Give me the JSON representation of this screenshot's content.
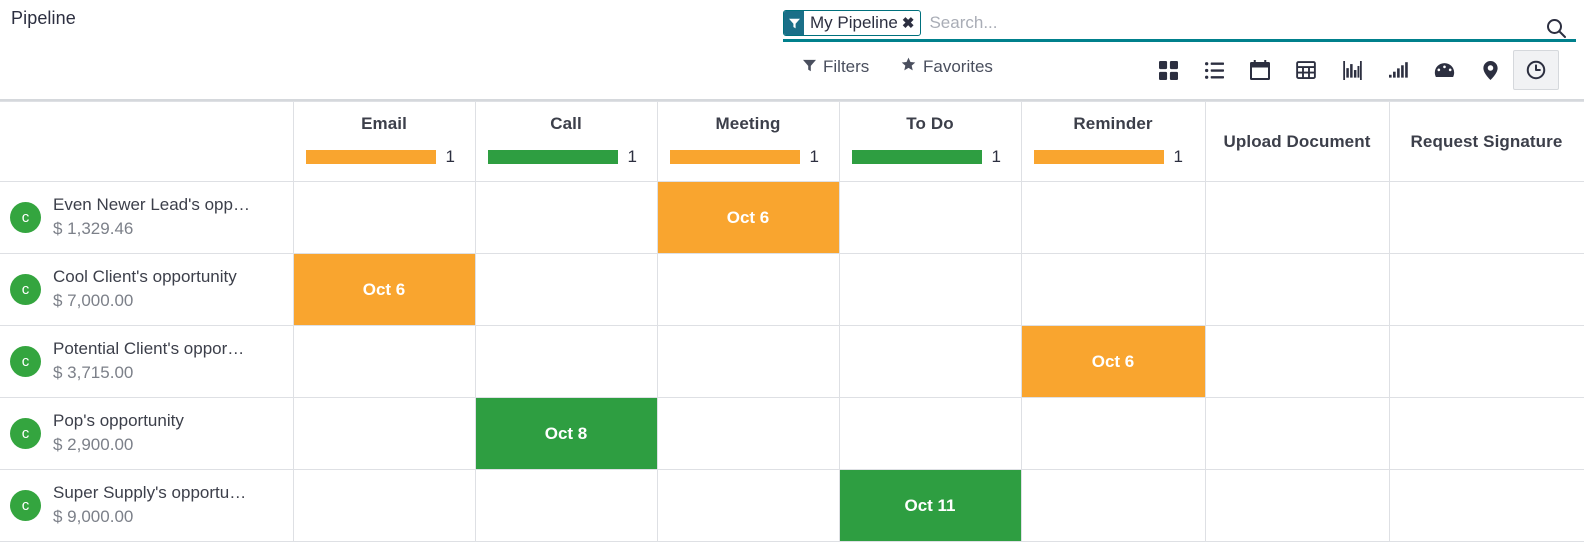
{
  "breadcrumb": "Pipeline",
  "search": {
    "facet": {
      "label": "My Pipeline",
      "icon": "filter-icon",
      "remove": "✖"
    },
    "placeholder": "Search...",
    "value": "",
    "magnifier_icon": "search-icon"
  },
  "controls": {
    "filters_label": "Filters",
    "favorites_label": "Favorites",
    "views": [
      {
        "name": "kanban",
        "label": "Kanban",
        "active": false
      },
      {
        "name": "list",
        "label": "List",
        "active": false
      },
      {
        "name": "calendar",
        "label": "Calendar",
        "active": false
      },
      {
        "name": "pivot",
        "label": "Pivot",
        "active": false
      },
      {
        "name": "graph",
        "label": "Graph",
        "active": false
      },
      {
        "name": "cohort",
        "label": "Cohort",
        "active": false
      },
      {
        "name": "dashboard",
        "label": "Dashboard",
        "active": false
      },
      {
        "name": "map",
        "label": "Map",
        "active": false
      },
      {
        "name": "activity",
        "label": "Activity",
        "active": true
      }
    ]
  },
  "colors": {
    "orange": "#f9a52f",
    "green": "#2e9e41",
    "avatar_green": "#34a53f",
    "accent_teal": "#00808c",
    "facet_blue": "#1a6f88"
  },
  "table": {
    "columns": [
      {
        "title": "Email",
        "bar": "orange",
        "count": "1"
      },
      {
        "title": "Call",
        "bar": "green",
        "count": "1"
      },
      {
        "title": "Meeting",
        "bar": "orange",
        "count": "1"
      },
      {
        "title": "To Do",
        "bar": "green",
        "count": "1"
      },
      {
        "title": "Reminder",
        "bar": "orange",
        "count": "1"
      },
      {
        "title": "Upload Document",
        "bar": null,
        "count": ""
      },
      {
        "title": "Request Signature",
        "bar": null,
        "count": ""
      }
    ],
    "rows": [
      {
        "avatar": "c",
        "name": "Even Newer Lead's opp…",
        "amount": "$ 1,329.46",
        "cells": [
          {
            "label": "",
            "state": "empty"
          },
          {
            "label": "",
            "state": "empty"
          },
          {
            "label": "Oct 6",
            "state": "orange"
          },
          {
            "label": "",
            "state": "empty"
          },
          {
            "label": "",
            "state": "empty"
          },
          {
            "label": "",
            "state": "empty"
          },
          {
            "label": "",
            "state": "empty"
          }
        ]
      },
      {
        "avatar": "c",
        "name": "Cool Client's opportunity",
        "amount": "$ 7,000.00",
        "cells": [
          {
            "label": "Oct 6",
            "state": "orange"
          },
          {
            "label": "",
            "state": "empty"
          },
          {
            "label": "",
            "state": "empty"
          },
          {
            "label": "",
            "state": "empty"
          },
          {
            "label": "",
            "state": "empty"
          },
          {
            "label": "",
            "state": "empty"
          },
          {
            "label": "",
            "state": "empty"
          }
        ]
      },
      {
        "avatar": "c",
        "name": "Potential Client's oppor…",
        "amount": "$ 3,715.00",
        "cells": [
          {
            "label": "",
            "state": "empty"
          },
          {
            "label": "",
            "state": "empty"
          },
          {
            "label": "",
            "state": "empty"
          },
          {
            "label": "",
            "state": "empty"
          },
          {
            "label": "Oct 6",
            "state": "orange"
          },
          {
            "label": "",
            "state": "empty"
          },
          {
            "label": "",
            "state": "empty"
          }
        ]
      },
      {
        "avatar": "c",
        "name": "Pop's opportunity",
        "amount": "$ 2,900.00",
        "cells": [
          {
            "label": "",
            "state": "empty"
          },
          {
            "label": "Oct 8",
            "state": "green"
          },
          {
            "label": "",
            "state": "empty"
          },
          {
            "label": "",
            "state": "empty"
          },
          {
            "label": "",
            "state": "empty"
          },
          {
            "label": "",
            "state": "empty"
          },
          {
            "label": "",
            "state": "empty"
          }
        ]
      },
      {
        "avatar": "c",
        "name": "Super Supply's opportu…",
        "amount": "$ 9,000.00",
        "cells": [
          {
            "label": "",
            "state": "empty"
          },
          {
            "label": "",
            "state": "empty"
          },
          {
            "label": "",
            "state": "empty"
          },
          {
            "label": "Oct 11",
            "state": "green"
          },
          {
            "label": "",
            "state": "empty"
          },
          {
            "label": "",
            "state": "empty"
          },
          {
            "label": "",
            "state": "empty"
          }
        ]
      }
    ]
  }
}
